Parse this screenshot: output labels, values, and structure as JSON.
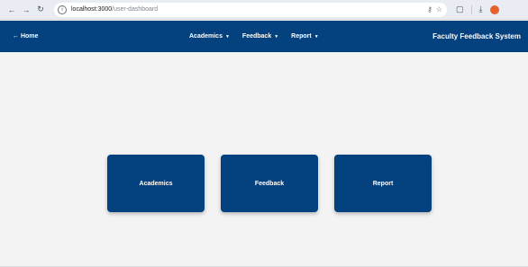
{
  "browser": {
    "url_host": "localhost:3000",
    "url_path": "/user-dashboard"
  },
  "navbar": {
    "home_label": "← Home",
    "menu": [
      {
        "label": "Academics"
      },
      {
        "label": "Feedback"
      },
      {
        "label": "Report"
      }
    ],
    "brand": "Faculty Feedback System"
  },
  "cards": [
    {
      "label": "Academics"
    },
    {
      "label": "Feedback"
    },
    {
      "label": "Report"
    }
  ],
  "colors": {
    "primary": "#04417f",
    "background": "#f3f3f3"
  },
  "icons": {
    "back": "back-arrow-icon",
    "forward": "forward-arrow-icon",
    "reload": "reload-icon",
    "site_info": "site-info-icon",
    "key": "key-icon",
    "star": "bookmark-star-icon",
    "extensions": "extensions-icon",
    "download": "download-icon",
    "profile": "profile-avatar-icon",
    "caret": "caret-down-icon"
  }
}
